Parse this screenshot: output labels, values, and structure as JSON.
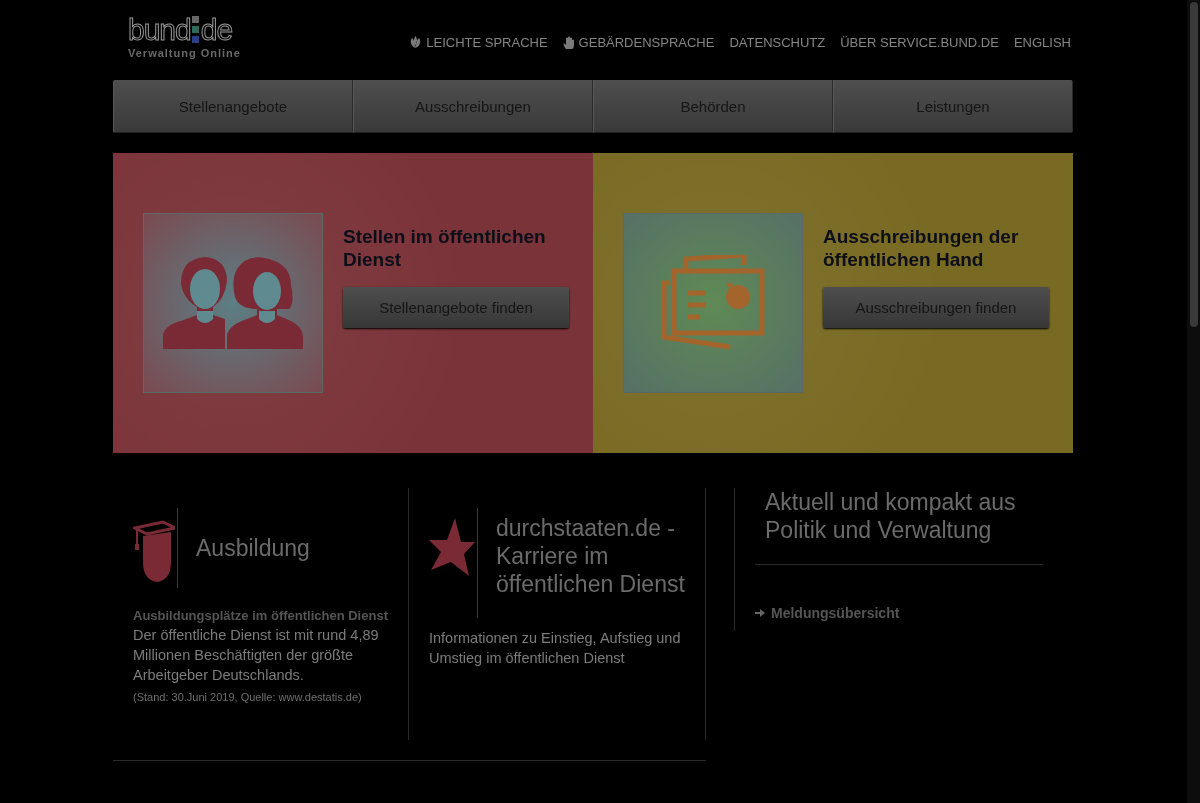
{
  "logo": {
    "name": "bund",
    "suffix": "de",
    "tagline": "Verwaltung Online"
  },
  "meta_links": [
    {
      "label": "LEICHTE SPRACHE",
      "kind": "leaf"
    },
    {
      "label": "GEBÄRDENSPRACHE",
      "kind": "hand"
    },
    {
      "label": "DATENSCHUTZ",
      "kind": "plain"
    },
    {
      "label": "ÜBER SERVICE.BUND.DE",
      "kind": "plain"
    },
    {
      "label": "ENGLISH",
      "kind": "plain"
    }
  ],
  "main_nav": [
    "Stellenangebote",
    "Ausschreibungen",
    "Behörden",
    "Leistungen"
  ],
  "hero_tiles": [
    {
      "kind": "people",
      "title": "Stellen im öffentlichen Dienst",
      "button": "Stellenangebote finden",
      "color": "#7a3339"
    },
    {
      "kind": "documents",
      "title": "Ausschreibungen der öffentlichen Hand",
      "button": "Ausschreibungen finden",
      "color": "#786a22"
    }
  ],
  "teasers": [
    {
      "kind": "graduation",
      "title": "Ausbildung",
      "subtitle": "Ausbildungsplätze im öffentlichen Dienst",
      "text": "Der öffentliche Dienst ist mit rund 4,89 Millionen Beschäftigten der größte Arbeitgeber Deutschlands.",
      "note": "(Stand: 30.Juni 2019, Quelle: www.destatis.de)"
    },
    {
      "kind": "star",
      "title": "durchstaaten.de - Karriere im öffentlichen Dienst",
      "text": "Informationen zu Einstieg, Aufstieg und Umstieg im öffentlichen Dienst"
    }
  ],
  "news": {
    "title": "Aktuell und kompakt aus Politik und Verwaltung",
    "link": "Meldungsübersicht"
  }
}
